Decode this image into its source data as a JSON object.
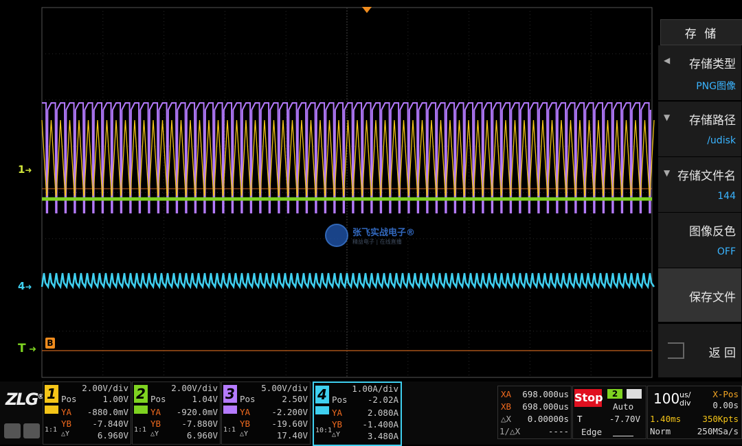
{
  "menu": {
    "title": "存 储",
    "items": [
      {
        "label": "存储类型",
        "value": "PNG图像"
      },
      {
        "label": "存储路径",
        "value": "/udisk"
      },
      {
        "label": "存储文件名",
        "value": "144"
      },
      {
        "label": "图像反色",
        "value": "OFF"
      },
      {
        "label": "保存文件",
        "value": ""
      },
      {
        "label": "返 回",
        "value": ""
      }
    ]
  },
  "markers": {
    "ch1": "1",
    "ch4": "4",
    "trigger": "T",
    "bus": "B"
  },
  "watermark": {
    "title": "张飞实战电子®",
    "subtitle": "精益电子 | 在线直播"
  },
  "channels": [
    {
      "num": "1",
      "color": "#f5c518",
      "scale": "2.00V/div",
      "pos_label": "Pos",
      "pos": "1.00V",
      "ya": "-880.0mV",
      "yb": "-7.840V",
      "dy": "6.960V",
      "probe": "1:1"
    },
    {
      "num": "2",
      "color": "#7ed321",
      "scale": "2.00V/div",
      "pos_label": "Pos",
      "pos": "1.04V",
      "ya": "-920.0mV",
      "yb": "-7.880V",
      "dy": "6.960V",
      "probe": "1:1"
    },
    {
      "num": "3",
      "color": "#b57bff",
      "scale": "5.00V/div",
      "pos_label": "Pos",
      "pos": "2.50V",
      "ya": "-2.200V",
      "yb": "-19.60V",
      "dy": "17.40V",
      "probe": "1:1"
    },
    {
      "num": "4",
      "color": "#3fd0f0",
      "scale": "1.00A/div",
      "pos_label": "Pos",
      "pos": "-2.02A",
      "ya": "2.080A",
      "yb": "-1.400A",
      "dy": "3.480A",
      "probe": "10:1"
    }
  ],
  "labels": {
    "ya": "YA",
    "yb": "YB",
    "dy": "△Y"
  },
  "cursor": {
    "xa_label": "XA",
    "xa": "698.000us",
    "xb_label": "XB",
    "xb": "698.000us",
    "dx_label": "△X",
    "dx": "0.00000s",
    "inv_label": "1/△X",
    "inv": "----"
  },
  "trigger": {
    "state": "Stop",
    "source": "2",
    "mode": "Auto",
    "t_label": "T",
    "level": "-7.70V",
    "type": "Edge"
  },
  "timebase": {
    "value": "100",
    "unit_top": "us/",
    "unit_bot": "div",
    "xpos_label": "X-Pos",
    "xpos": "0.00s",
    "delay": "1.40ms",
    "points": "350Kpts",
    "acq": "Norm",
    "rate": "250MSa/s"
  },
  "logo": "ZLG"
}
